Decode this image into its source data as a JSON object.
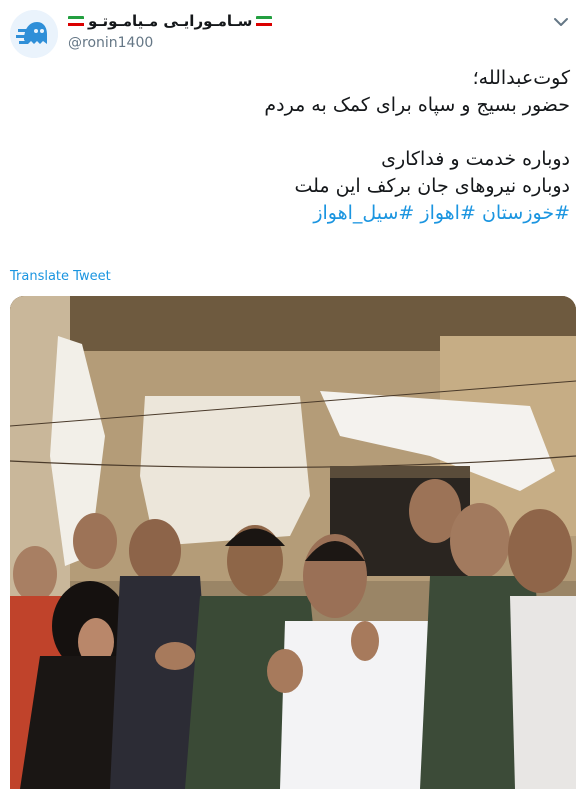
{
  "author": {
    "display_name": "سـامـورایـی مـیامـوتـو",
    "handle": "@ronin1400",
    "avatar_icon": "avatar-ghost-logo-icon"
  },
  "tweet": {
    "lines": [
      "کوت‌عبدالله؛",
      "حضور بسیج و سپاه برای کمک به مردم",
      "",
      "دوباره خدمت و فداکاری",
      "دوباره نیروهای جان برکف این ملت"
    ],
    "hashtags": [
      "#خوزستان",
      "#اهواز",
      "#سیل_اهواز"
    ]
  },
  "translate_label": "Translate Tweet",
  "colors": {
    "link": "#1b95e0",
    "text": "#14171a",
    "secondary": "#657786",
    "flag_green": "#239f40",
    "flag_white": "#ffffff",
    "flag_red": "#da0000"
  },
  "icons": {
    "menu": "chevron-down-icon",
    "flag": "iran-flag-icon"
  }
}
